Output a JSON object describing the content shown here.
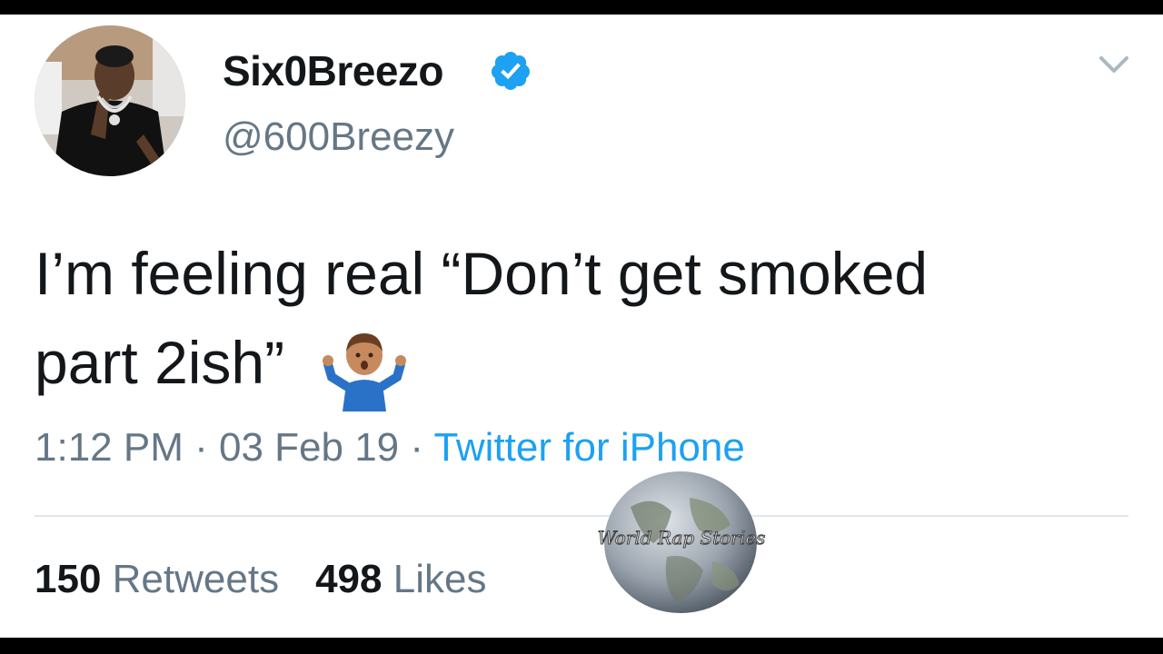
{
  "tweet": {
    "display_name": "Six0Breezo",
    "handle": "@600Breezy",
    "verified_icon": "verified-badge-icon",
    "menu_icon": "chevron-down-icon",
    "text_line_1": "I’m feeling real “Don’t get smoked",
    "text_line_2": "part 2ish”",
    "emoji": "man-shrugging-emoji",
    "time": "1:12 PM",
    "separator": " · ",
    "date": "03 Feb 19",
    "source": "Twitter for iPhone",
    "retweets_count": "150",
    "retweets_label": "Retweets",
    "likes_count": "498",
    "likes_label": "Likes"
  },
  "watermark": {
    "text": "World Rap Stories"
  },
  "colors": {
    "text_primary": "#14171a",
    "text_secondary": "#657786",
    "link": "#1da1f2",
    "verified": "#1da1f2",
    "divider": "#e1e8ed"
  }
}
